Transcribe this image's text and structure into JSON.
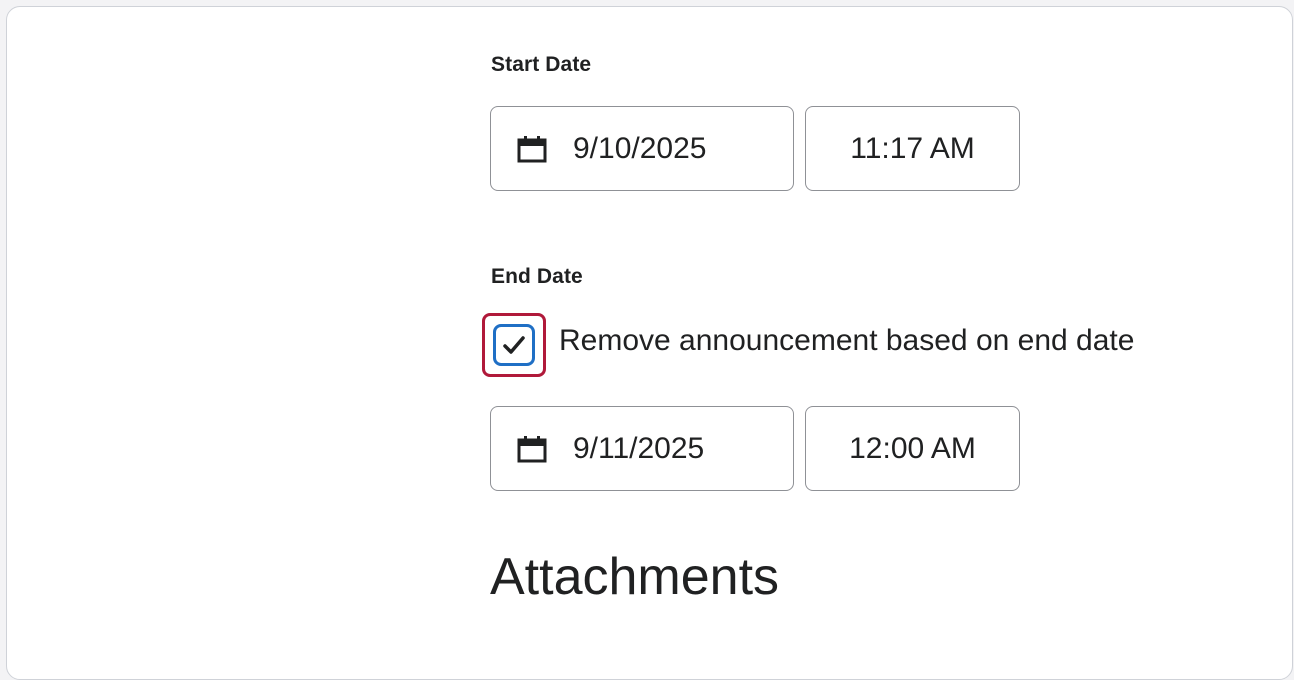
{
  "start_date": {
    "label": "Start Date",
    "date_value": "9/10/2025",
    "time_value": "11:17 AM"
  },
  "end_date": {
    "label": "End Date",
    "remove_checkbox_label": "Remove announcement based on end date",
    "remove_checkbox_checked": true,
    "date_value": "9/11/2025",
    "time_value": "12:00 AM"
  },
  "attachments": {
    "heading": "Attachments"
  },
  "icons": {
    "date_icon": "calendar-icon",
    "checkbox_icon": "checkmark-icon"
  },
  "colors": {
    "focus_ring": "#b0193a",
    "checkbox_border": "#1f6fc5",
    "text": "#202122",
    "field_border": "#8f9196"
  }
}
